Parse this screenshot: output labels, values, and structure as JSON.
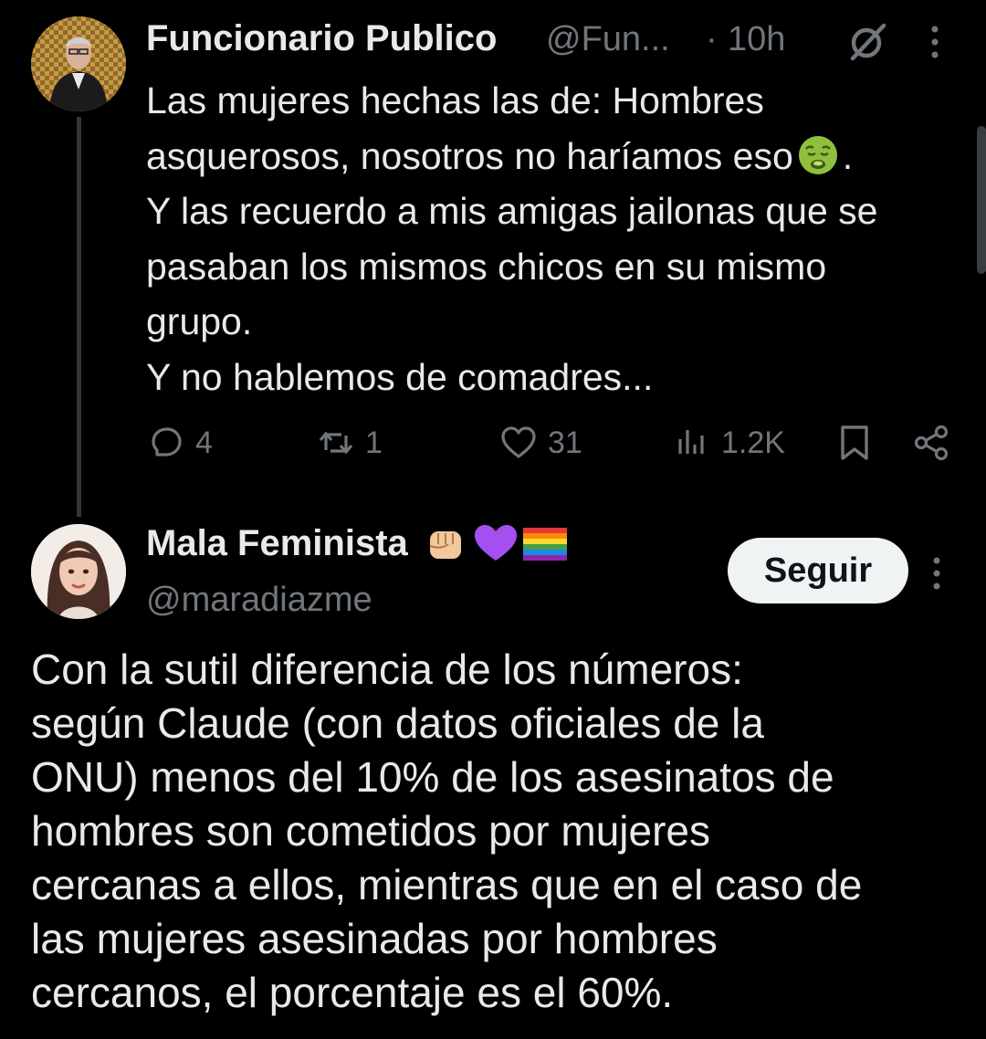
{
  "tweet1": {
    "name": "Funcionario Publico",
    "handle": "@Fun...",
    "dot": "·",
    "time": "10h",
    "lines": [
      "Las mujeres hechas las de: Hombres",
      "asquerosos, nosotros no haríamos eso",
      ".",
      "Y las recuerdo a mis amigas jailonas que se",
      "pasaban los mismos chicos en su mismo",
      "grupo.",
      "Y no hablemos de comadres..."
    ],
    "emoji": "nauseated-face",
    "actions": {
      "replies": "4",
      "retweets": "1",
      "likes": "31",
      "views": "1.2K"
    }
  },
  "tweet2": {
    "name": "Mala Feminista",
    "name_emojis": [
      "raised-fist",
      "purple-heart",
      "rainbow-flag"
    ],
    "handle": "@maradiazme",
    "follow_label": "Seguir",
    "lines": [
      "Con la sutil diferencia de los números:",
      "según Claude (con datos oficiales de la",
      "ONU) menos del 10% de los asesinatos de",
      "hombres son cometidos por mujeres",
      "cercanas a ellos, mientras que en el caso de",
      "las mujeres asesinadas por hombres",
      "cercanos, el porcentaje es el 60%."
    ]
  },
  "colors": {
    "background": "#000000",
    "text": "#e7e9ea",
    "muted": "#71767b",
    "button_bg": "#eff3f4"
  }
}
